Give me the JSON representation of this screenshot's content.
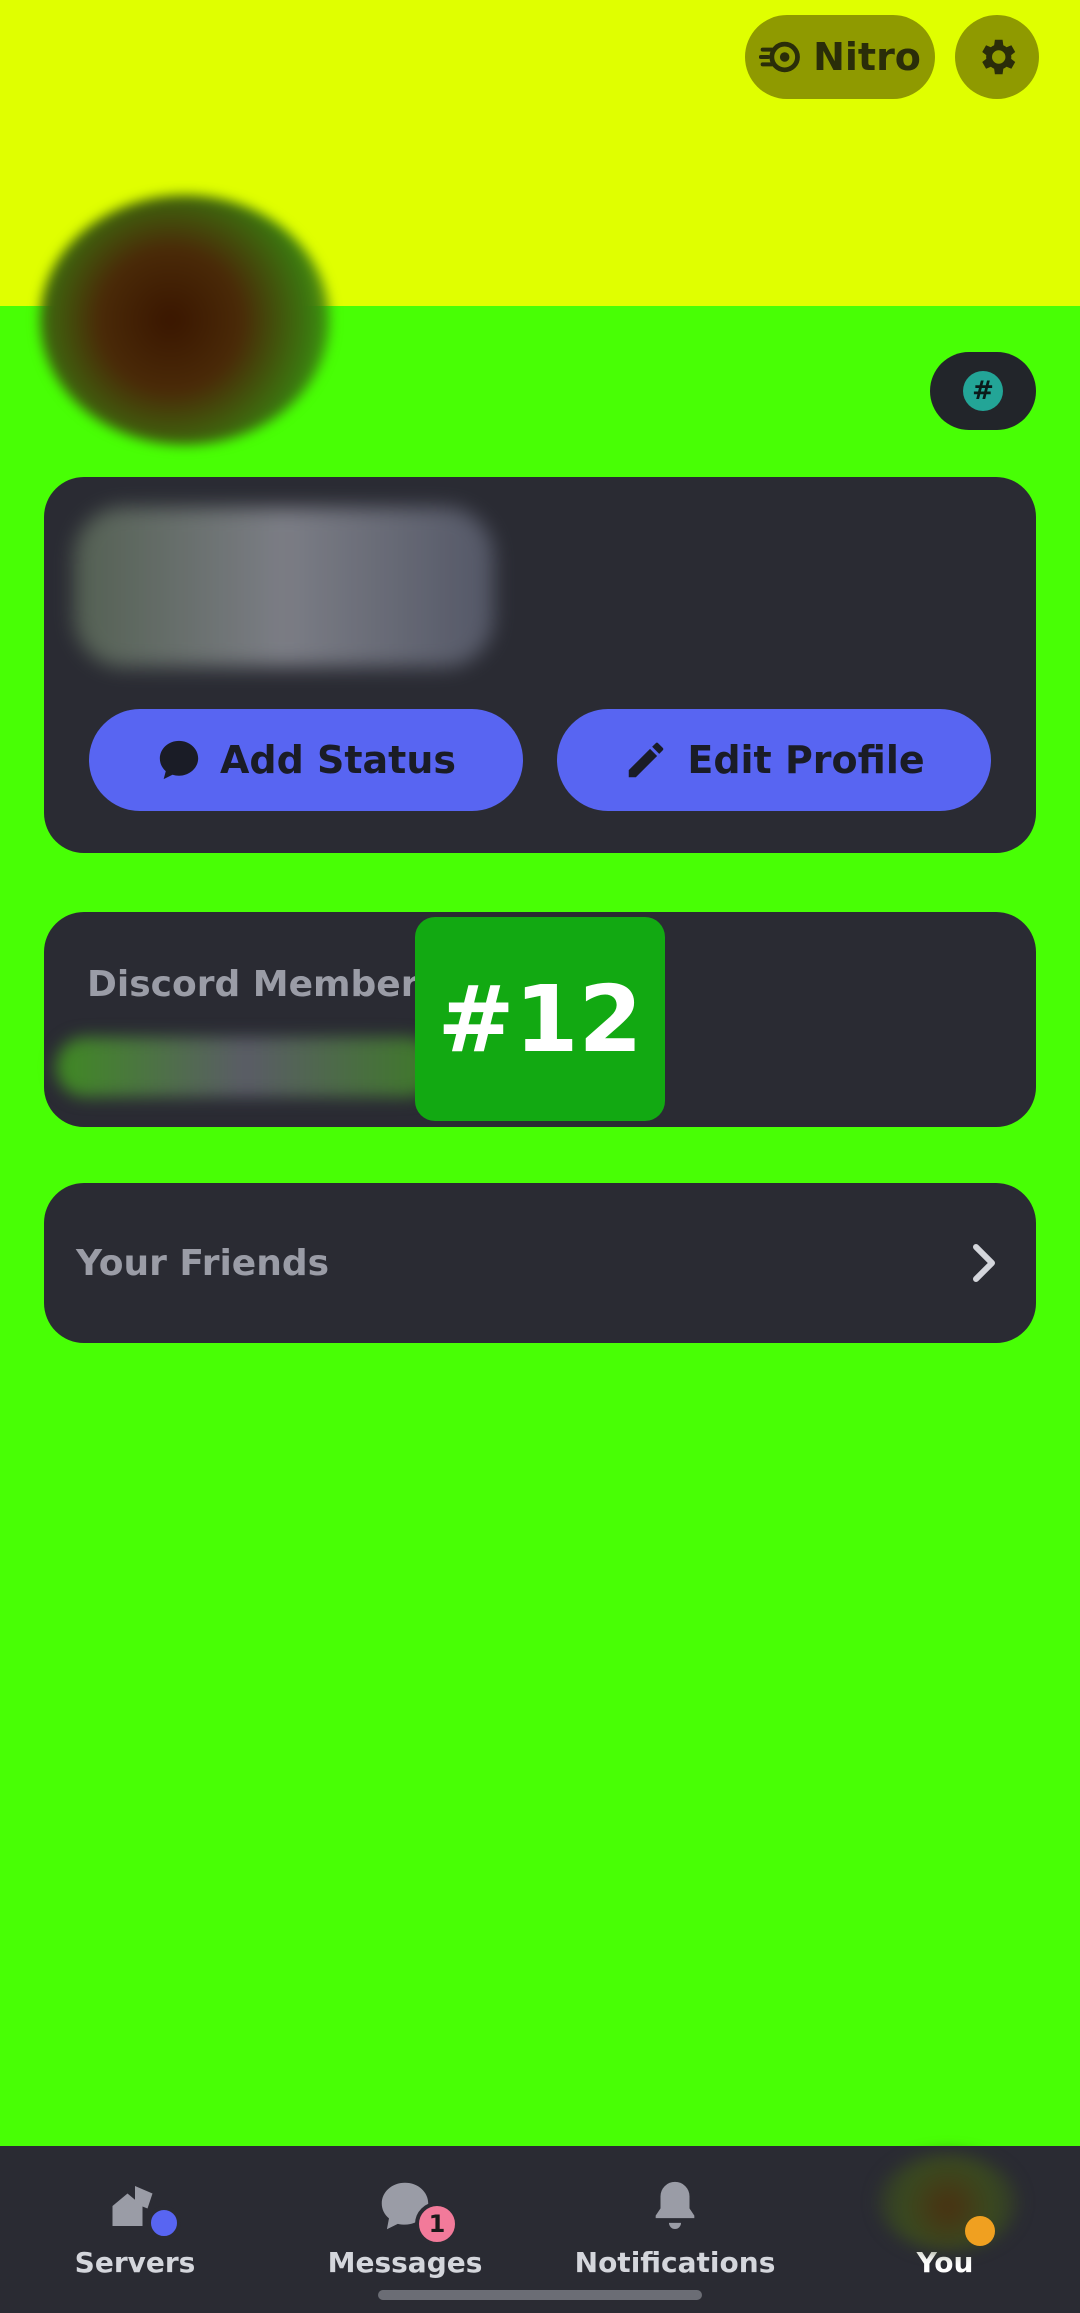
{
  "header": {
    "nitro_label": "Nitro",
    "nitro_icon": "nitro-icon",
    "settings_icon": "gear-icon"
  },
  "profile": {
    "badge_icon": "hash-icon",
    "badge_text": "#",
    "add_status_label": "Add Status",
    "edit_profile_label": "Edit Profile"
  },
  "member_card": {
    "title": "Discord Member Since"
  },
  "overlay_tag": "#12",
  "friends_card": {
    "label": "Your Friends"
  },
  "bottom_nav": {
    "items": [
      {
        "label": "Servers",
        "icon": "servers-icon"
      },
      {
        "label": "Messages",
        "icon": "messages-icon",
        "badge": "1"
      },
      {
        "label": "Notifications",
        "icon": "bell-icon"
      },
      {
        "label": "You",
        "icon": "avatar"
      }
    ]
  },
  "colors": {
    "banner": "#e0ff00",
    "background": "#48ff05",
    "card": "#2a2b33",
    "accent": "#5865f2",
    "tag": "#12a912"
  }
}
